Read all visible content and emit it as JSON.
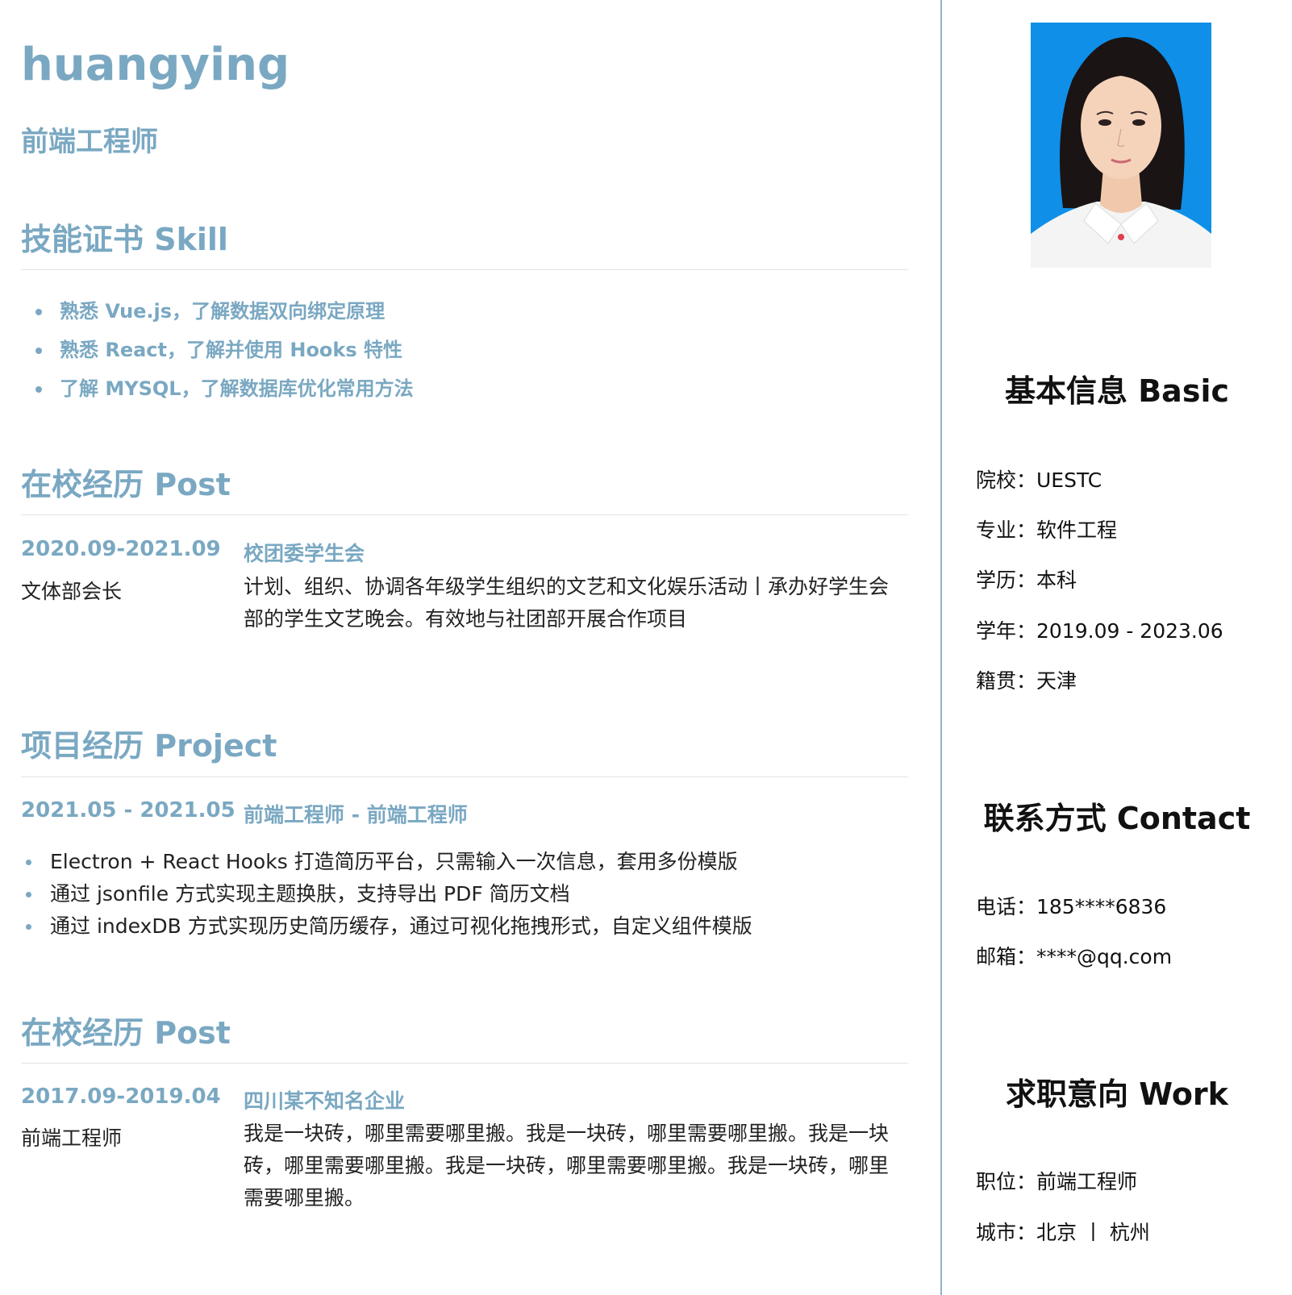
{
  "header": {
    "name": "huangying",
    "role": "前端工程师"
  },
  "skills": {
    "title": "技能证书 Skill",
    "items": [
      "熟悉 Vue.js，了解数据双向绑定原理",
      "熟悉 React，了解并使用 Hooks 特性",
      "了解 MYSQL，了解数据库优化常用方法"
    ]
  },
  "post1": {
    "title": "在校经历 Post",
    "date": "2020.09-2021.09",
    "org": "校团委学生会",
    "position": "文体部会长",
    "desc": "计划、组织、协调各年级学生组织的文艺和文化娱乐活动丨承办好学生会部的学生文艺晚会。有效地与社团部开展合作项目"
  },
  "project": {
    "title": "项目经历 Project",
    "date": "2021.05 - 2021.05",
    "role": "前端工程师 - 前端工程师",
    "items": [
      "Electron + React Hooks 打造简历平台，只需输入一次信息，套用多份模版",
      "通过 jsonfile 方式实现主题换肤，支持导出 PDF 简历文档",
      "通过 indexDB 方式实现历史简历缓存，通过可视化拖拽形式，自定义组件模版"
    ]
  },
  "post2": {
    "title": "在校经历 Post",
    "date": "2017.09-2019.04",
    "org": "四川某不知名企业",
    "position": "前端工程师",
    "desc": "我是一块砖，哪里需要哪里搬。我是一块砖，哪里需要哪里搬。我是一块砖，哪里需要哪里搬。我是一块砖，哪里需要哪里搬。我是一块砖，哪里需要哪里搬。"
  },
  "basic": {
    "title": "基本信息 Basic",
    "school": "院校：UESTC",
    "major": "专业：软件工程",
    "degree": "学历：本科",
    "years": "学年：2019.09 - 2023.06",
    "hometown": "籍贯：天津"
  },
  "contact": {
    "title": "联系方式 Contact",
    "phone": "电话：185****6836",
    "email": "邮箱：****@qq.com"
  },
  "work": {
    "title": "求职意向 Work",
    "position": "职位：前端工程师",
    "city": "城市：北京 丨 杭州"
  },
  "colors": {
    "accent": "#7aa8c2",
    "photo_bg": "#0f8fe8",
    "divider": "#8db5c9"
  }
}
